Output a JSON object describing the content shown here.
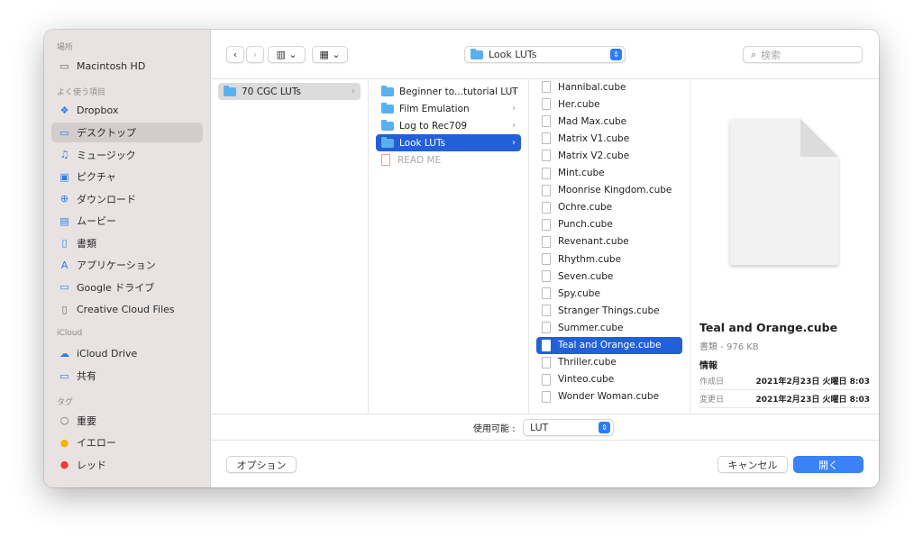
{
  "sidebar": {
    "sections": [
      {
        "title": "場所",
        "items": [
          {
            "label": "Macintosh HD",
            "icon": "drive-icon"
          }
        ]
      },
      {
        "title": "よく使う項目",
        "items": [
          {
            "label": "Dropbox",
            "icon": "dropbox-icon"
          },
          {
            "label": "デスクトップ",
            "icon": "desktop-icon",
            "selected": true
          },
          {
            "label": "ミュージック",
            "icon": "music-icon"
          },
          {
            "label": "ピクチャ",
            "icon": "photo-icon"
          },
          {
            "label": "ダウンロード",
            "icon": "download-icon"
          },
          {
            "label": "ムービー",
            "icon": "movie-icon"
          },
          {
            "label": "書類",
            "icon": "document-icon"
          },
          {
            "label": "アプリケーション",
            "icon": "applications-icon"
          },
          {
            "label": "Google ドライブ",
            "icon": "folder-icon"
          },
          {
            "label": "Creative Cloud Files",
            "icon": "file-icon"
          }
        ]
      },
      {
        "title": "iCloud",
        "items": [
          {
            "label": "iCloud Drive",
            "icon": "cloud-icon"
          },
          {
            "label": "共有",
            "icon": "shared-folder-icon"
          }
        ]
      },
      {
        "title": "タグ",
        "items": [
          {
            "label": "重要",
            "icon": "tag-empty-icon"
          },
          {
            "label": "イエロー",
            "icon": "tag-yellow-icon",
            "color": "#f5b400"
          },
          {
            "label": "レッド",
            "icon": "tag-red-icon",
            "color": "#f03a2f"
          }
        ]
      }
    ]
  },
  "toolbar": {
    "location": "Look LUTs",
    "search_placeholder": "検索"
  },
  "columns": [
    [
      {
        "label": "70 CGC LUTs",
        "type": "folder",
        "state": "path"
      }
    ],
    [
      {
        "label": "Beginner to...tutorial LUT",
        "type": "folder"
      },
      {
        "label": "Film Emulation",
        "type": "folder"
      },
      {
        "label": "Log to Rec709",
        "type": "folder"
      },
      {
        "label": "Look LUTs",
        "type": "folder",
        "state": "selected"
      },
      {
        "label": "READ ME",
        "type": "pdf",
        "disabled": true
      }
    ],
    [
      {
        "label": "Hannibal.cube"
      },
      {
        "label": "Her.cube"
      },
      {
        "label": "Mad Max.cube"
      },
      {
        "label": "Matrix V1.cube"
      },
      {
        "label": "Matrix V2.cube"
      },
      {
        "label": "Mint.cube"
      },
      {
        "label": "Moonrise Kingdom.cube"
      },
      {
        "label": "Ochre.cube"
      },
      {
        "label": "Punch.cube"
      },
      {
        "label": "Revenant.cube"
      },
      {
        "label": "Rhythm.cube"
      },
      {
        "label": "Seven.cube"
      },
      {
        "label": "Spy.cube"
      },
      {
        "label": "Stranger Things.cube"
      },
      {
        "label": "Summer.cube"
      },
      {
        "label": "Teal and Orange.cube",
        "state": "selected"
      },
      {
        "label": "Thriller.cube"
      },
      {
        "label": "Vinteo.cube"
      },
      {
        "label": "Wonder Woman.cube"
      }
    ]
  ],
  "preview": {
    "name": "Teal and Orange.cube",
    "kind": "書類 - 976 KB",
    "info_title": "情報",
    "created_label": "作成日",
    "created": "2021年2月23日 火曜日 8:03",
    "modified_label": "変更日",
    "modified": "2021年2月23日 火曜日 8:03"
  },
  "filter": {
    "label": "使用可能 :",
    "value": "LUT"
  },
  "buttons": {
    "options": "オプション",
    "cancel": "キャンセル",
    "open": "開く"
  },
  "colors": {
    "accent": "#2360d8",
    "open_button": "#3a82f6"
  }
}
